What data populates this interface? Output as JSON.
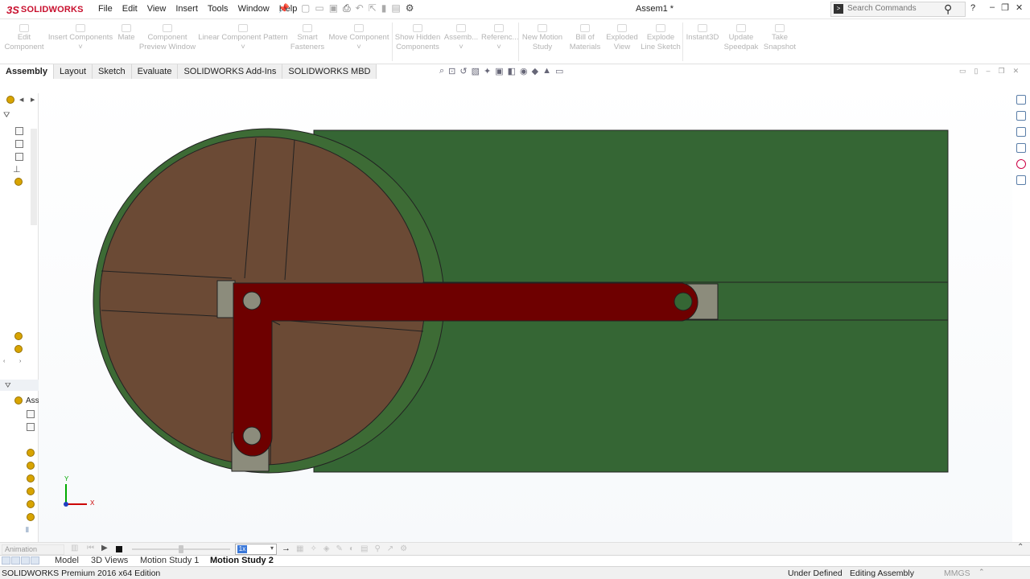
{
  "app": {
    "logo_ds": "3S",
    "logo_name": "SOLIDWORKS",
    "document_title": "Assem1 *"
  },
  "menu": [
    "File",
    "Edit",
    "View",
    "Insert",
    "Tools",
    "Window",
    "Help"
  ],
  "search": {
    "placeholder": "Search Commands"
  },
  "window_controls": {
    "help": "?",
    "minimize": "–",
    "restore": "❐",
    "close": "✕"
  },
  "commands": [
    {
      "line1": "Edit",
      "line2": "Component"
    },
    {
      "line1": "Insert Components",
      "line2": ""
    },
    {
      "line1": "Mate",
      "line2": ""
    },
    {
      "line1": "Component",
      "line2": "Preview Window"
    },
    {
      "line1": "Linear Component Pattern",
      "line2": ""
    },
    {
      "line1": "Smart",
      "line2": "Fasteners"
    },
    {
      "line1": "Move Component",
      "line2": ""
    },
    {
      "line1": "Show Hidden",
      "line2": "Components"
    },
    {
      "line1": "Assemb...",
      "line2": ""
    },
    {
      "line1": "Referenc...",
      "line2": ""
    },
    {
      "line1": "New Motion",
      "line2": "Study"
    },
    {
      "line1": "Bill of",
      "line2": "Materials"
    },
    {
      "line1": "Exploded",
      "line2": "View"
    },
    {
      "line1": "Explode",
      "line2": "Line Sketch"
    },
    {
      "line1": "Instant3D",
      "line2": ""
    },
    {
      "line1": "Update",
      "line2": "Speedpak"
    },
    {
      "line1": "Take",
      "line2": "Snapshot"
    }
  ],
  "tabs": [
    "Assembly",
    "Layout",
    "Sketch",
    "Evaluate",
    "SOLIDWORKS Add-Ins",
    "SOLIDWORKS MBD"
  ],
  "active_tab": "Assembly",
  "tree": {
    "root_label": "Ass"
  },
  "triad": {
    "x_label": "X",
    "y_label": "Y"
  },
  "animation": {
    "type": "Animation",
    "speed": "1x",
    "slider_fraction": 0.5
  },
  "bottom_tabs": [
    "Model",
    "3D Views",
    "Motion Study 1",
    "Motion Study 2"
  ],
  "active_bottom_tab": "Motion Study 2",
  "status": {
    "edition": "SOLIDWORKS Premium 2016 x64 Edition",
    "definition": "Under Defined",
    "mode": "Editing Assembly",
    "units": "MMGS"
  },
  "colors": {
    "base_plate": "#356634",
    "disk": "#6b4a35",
    "rim": "#3d6b35",
    "link": "#6e0000",
    "slider_block": "#8c8c7c",
    "brand": "#c8102e"
  }
}
